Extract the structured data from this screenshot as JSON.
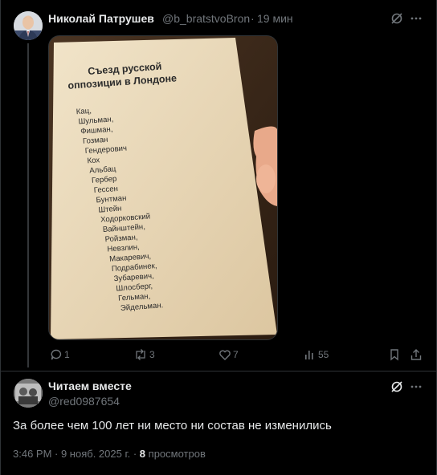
{
  "post": {
    "author_name": "Николай Патрушев",
    "handle": "@b_bratstvoBron",
    "separator": "·",
    "time": "19 мин",
    "image": {
      "title_line1": "Съезд русской",
      "title_line2": "оппозиции в Лондоне",
      "names": [
        "Кац,",
        "Шульман,",
        "Фишман,",
        "Гозман",
        "Гендерович",
        "Кох",
        "Альбац",
        "Гербер",
        "Гессен",
        "Бунтман",
        "Штейн",
        "Ходорковский",
        "Вайнштейн,",
        "Ройзман,",
        "Невзлин,",
        "Макаревич,",
        "Подрабинек,",
        "Зубаревич,",
        "Шлосберг,",
        "Гельман,",
        "Эйдельман."
      ]
    },
    "actions": {
      "replies": "1",
      "reposts": "3",
      "likes": "7",
      "views": "55"
    }
  },
  "reply": {
    "author_name": "Читаем вместе",
    "handle": "@red0987654",
    "text": "За более чем 100 лет ни место ни состав не изменились",
    "time": "3:46 PM · 9 нояб. 2025 г. ·",
    "views_count": "8",
    "views_label": "просмотров"
  },
  "colors": {
    "background": "#000000",
    "muted": "#71767b",
    "text": "#e7e9ea",
    "divider": "#2f3336"
  },
  "icons": [
    "grok-icon",
    "more-icon",
    "reply-icon",
    "repost-icon",
    "like-icon",
    "views-icon",
    "bookmark-icon",
    "share-icon"
  ]
}
